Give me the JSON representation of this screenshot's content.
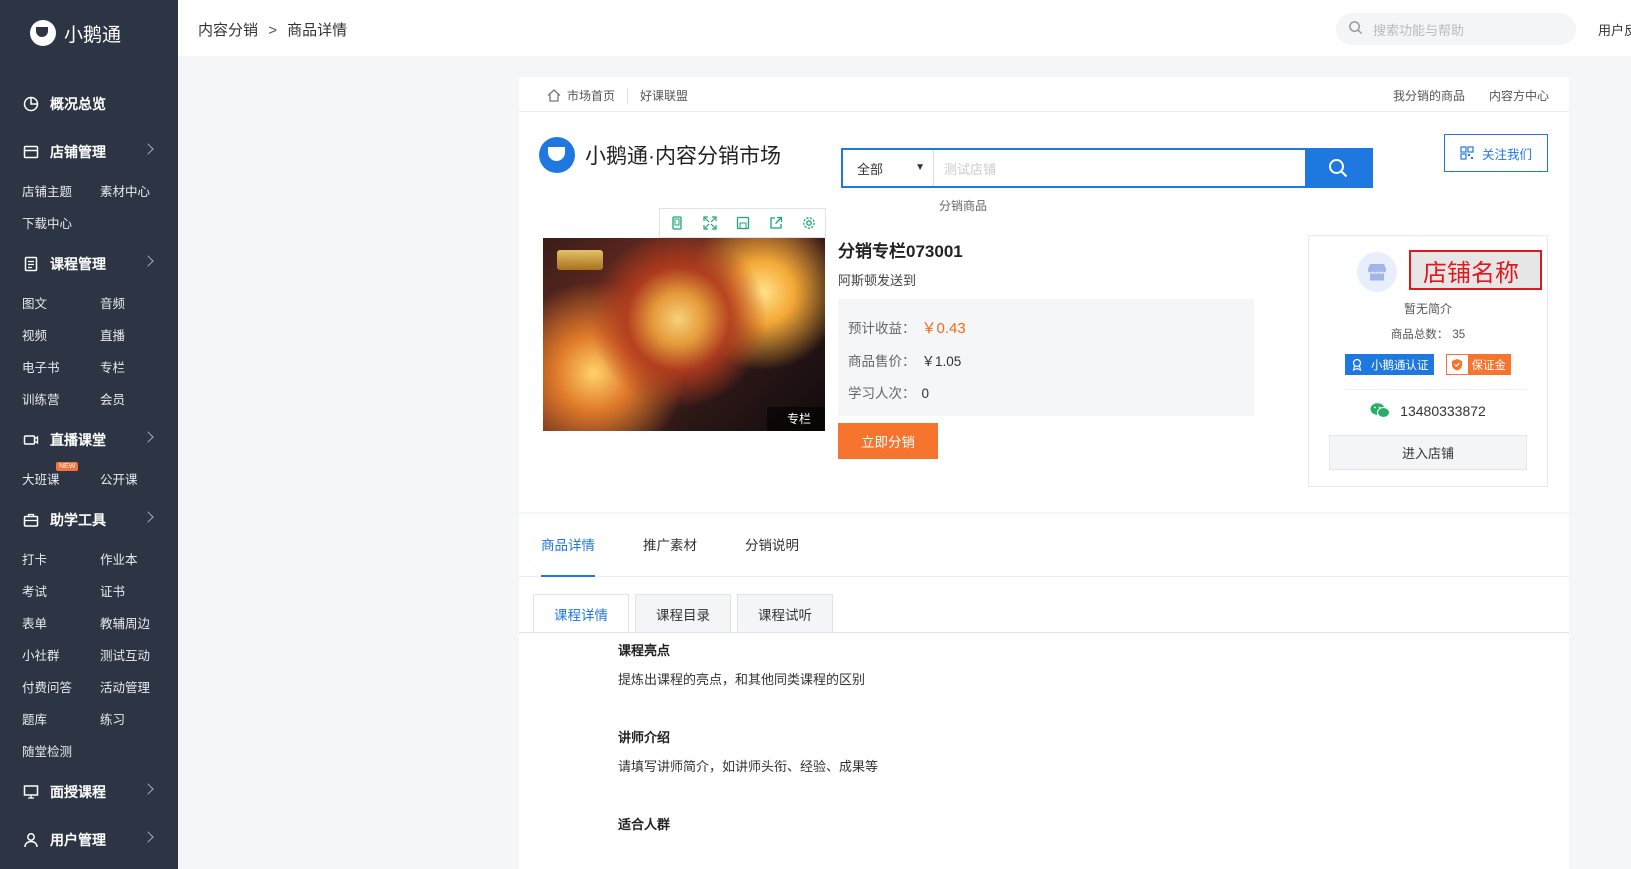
{
  "app": {
    "name": "小鹅通"
  },
  "sidebar": {
    "sections": [
      {
        "label": "概况总览",
        "icon": "chart-pie-icon",
        "items": []
      },
      {
        "label": "店铺管理",
        "icon": "store-icon",
        "items": [
          "店铺主题",
          "素材中心",
          "下载中心"
        ]
      },
      {
        "label": "课程管理",
        "icon": "document-icon",
        "items": [
          "图文",
          "音频",
          "视频",
          "直播",
          "电子书",
          "专栏",
          "训练营",
          "会员"
        ]
      },
      {
        "label": "直播课堂",
        "icon": "video-camera-icon",
        "items": [
          "大班课",
          "公开课"
        ],
        "badge": "NEW"
      },
      {
        "label": "助学工具",
        "icon": "toolbox-icon",
        "items": [
          "打卡",
          "作业本",
          "考试",
          "证书",
          "表单",
          "教辅周边",
          "小社群",
          "测试互动",
          "付费问答",
          "活动管理",
          "题库",
          "练习",
          "随堂检测"
        ]
      },
      {
        "label": "面授课程",
        "icon": "classroom-icon",
        "items": []
      },
      {
        "label": "用户管理",
        "icon": "user-icon",
        "items": []
      }
    ]
  },
  "topbar": {
    "breadcrumb": [
      "内容分销",
      "商品详情"
    ],
    "breadcrumb_sep": ">",
    "search_placeholder": "搜索功能与帮助",
    "user_text": "用户反"
  },
  "market": {
    "nav_left": [
      "市场首页",
      "好课联盟"
    ],
    "nav_right": [
      "我分销的商品",
      "内容方中心"
    ],
    "brand_title": "小鹅通·内容分销市场",
    "search_scope": "全部",
    "search_placeholder": "测试店铺",
    "search_hint": "分销商品",
    "follow_label": "关注我们"
  },
  "product": {
    "cover_tag": "专栏",
    "title": "分销专栏073001",
    "subtitle": "阿斯顿发送到",
    "rows": [
      {
        "label": "预计收益：",
        "value": "￥0.43",
        "highlight": true
      },
      {
        "label": "商品售价：",
        "value": "￥1.05",
        "highlight": false
      },
      {
        "label": "学习人次：",
        "value": "0",
        "highlight": false
      }
    ],
    "distribute_label": "立即分销"
  },
  "shop": {
    "name": "店铺名称",
    "intro": "暂无简介",
    "count_label": "商品总数：",
    "count_value": "35",
    "badge_verified": "小鹅通认证",
    "badge_deposit": "保证金",
    "phone": "13480333872",
    "enter_label": "进入店铺"
  },
  "detail": {
    "tabs": [
      "商品详情",
      "推广素材",
      "分销说明"
    ],
    "subtabs": [
      "课程详情",
      "课程目录",
      "课程试听"
    ],
    "sections": [
      {
        "heading": "课程亮点",
        "text": "提炼出课程的亮点，和其他同类课程的区别"
      },
      {
        "heading": "讲师介绍",
        "text": "请填写讲师简介，如讲师头衔、经验、成果等"
      },
      {
        "heading": "适合人群",
        "text": ""
      }
    ]
  },
  "colors": {
    "sidebar_bg": "#2d3544",
    "brand_blue": "#1f77e0",
    "accent_orange": "#f6742d",
    "highlight_red": "#e0171c"
  }
}
